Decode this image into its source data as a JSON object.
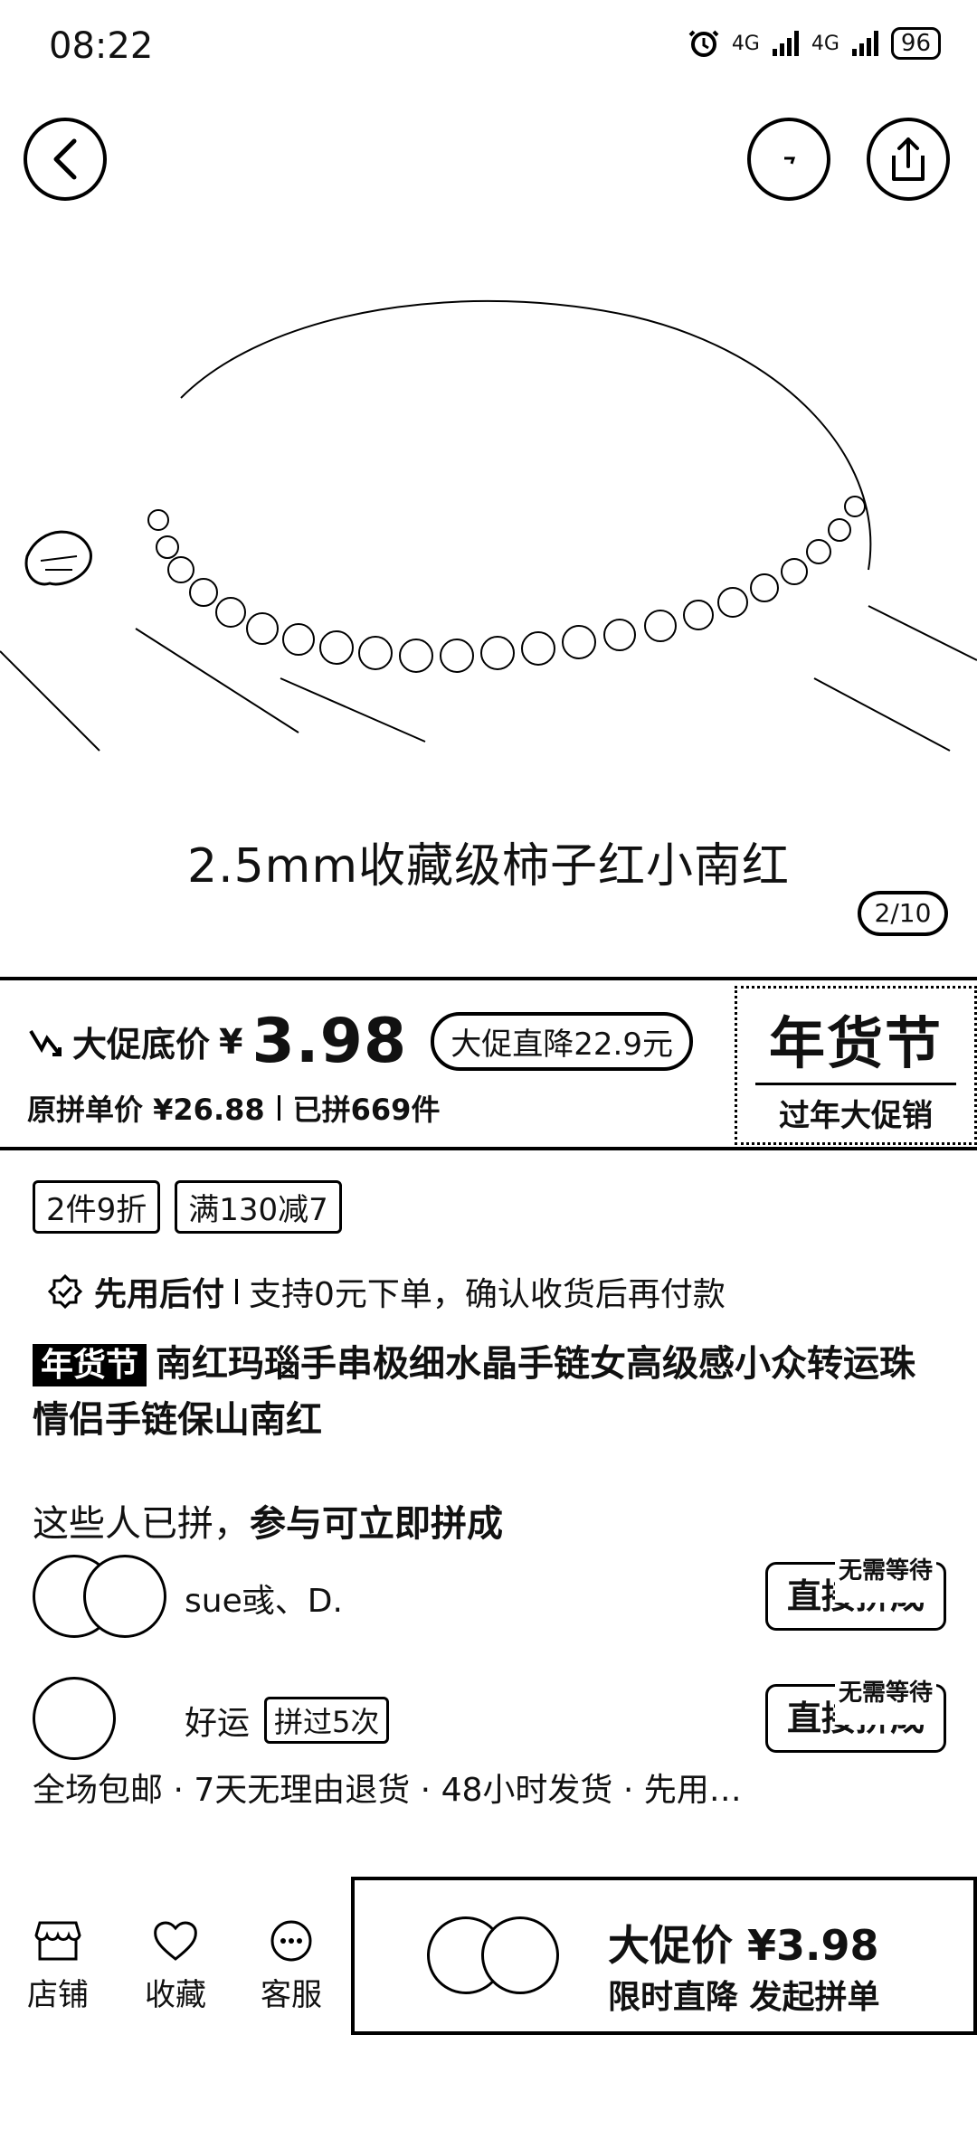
{
  "status_bar": {
    "time": "08:22",
    "network_1": "4G",
    "network_2": "4G",
    "battery": "96"
  },
  "hero": {
    "caption": "2.5mm收藏级柿子红小南红",
    "pager": "2/10"
  },
  "promo": {
    "label": "大促底价",
    "currency": "¥",
    "price": "3.98",
    "drop_tag": "大促直降22.9元",
    "original_price_text": "原拼单价 ¥26.88",
    "sold_text": "已拼669件",
    "festival_big": "年货节",
    "festival_small": "过年大促销"
  },
  "tags": [
    "2件9折",
    "满130减7"
  ],
  "pay_later": {
    "title": "先用后付",
    "desc": "支持0元下单，确认收货后再付款"
  },
  "product": {
    "festival_tag": "年货节",
    "title": "南红玛瑙手串极细水晶手链女高级感小众转运珠情侣手链保山南红"
  },
  "group": {
    "heading_normal": "这些人已拼，",
    "heading_bold": "参与可立即拼成",
    "users": [
      {
        "name": "sue彧、D.",
        "badge": "",
        "button": "直接拼成",
        "hint": "无需等待"
      },
      {
        "name": "好运",
        "badge": "拼过5次",
        "button": "直接拼成",
        "hint": "无需等待"
      }
    ]
  },
  "services": "全场包邮 · 7天无理由退货 · 48小时发货 · 先用…",
  "bottom_nav": {
    "shop": "店铺",
    "favorite": "收藏",
    "service": "客服"
  },
  "cta": {
    "price_label": "大促价 ¥3.98",
    "sub_label": "限时直降 发起拼单"
  }
}
